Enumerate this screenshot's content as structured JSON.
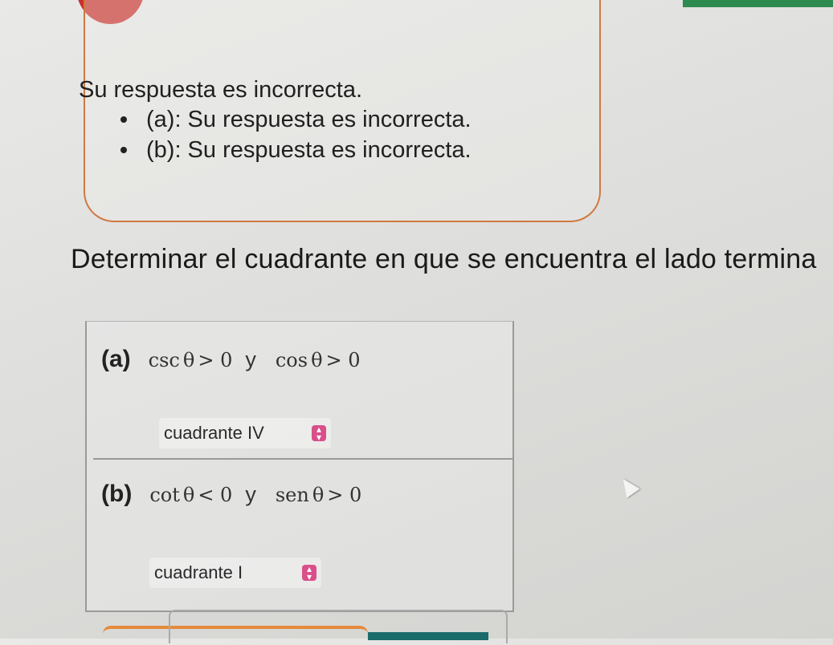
{
  "feedback": {
    "message": "Su respuesta es incorrecta.",
    "items": [
      "(a): Su respuesta es incorrecta.",
      "(b): Su respuesta es incorrecta."
    ]
  },
  "instruction": "Determinar el cuadrante en que se encuentra el lado termina",
  "problems": [
    {
      "label": "(a)",
      "cond1_func": "csc",
      "cond1_rel": "> 0",
      "connector": "y",
      "cond2_func": "cos",
      "cond2_rel": "> 0",
      "selected": "cuadrante IV"
    },
    {
      "label": "(b)",
      "cond1_func": "cot",
      "cond1_rel": "< 0",
      "connector": "y",
      "cond2_func": "sen",
      "cond2_rel": "> 0",
      "selected": "cuadrante I"
    }
  ],
  "symbols": {
    "theta": "θ"
  },
  "colors": {
    "accent_green": "#2e8b4f",
    "badge_red": "#c9302c",
    "feedback_border": "#d07840",
    "dropdown_arrow": "#d94f8a"
  },
  "icons": {
    "dropdown": "select-arrows-icon",
    "cursor": "mouse-pointer-icon"
  }
}
